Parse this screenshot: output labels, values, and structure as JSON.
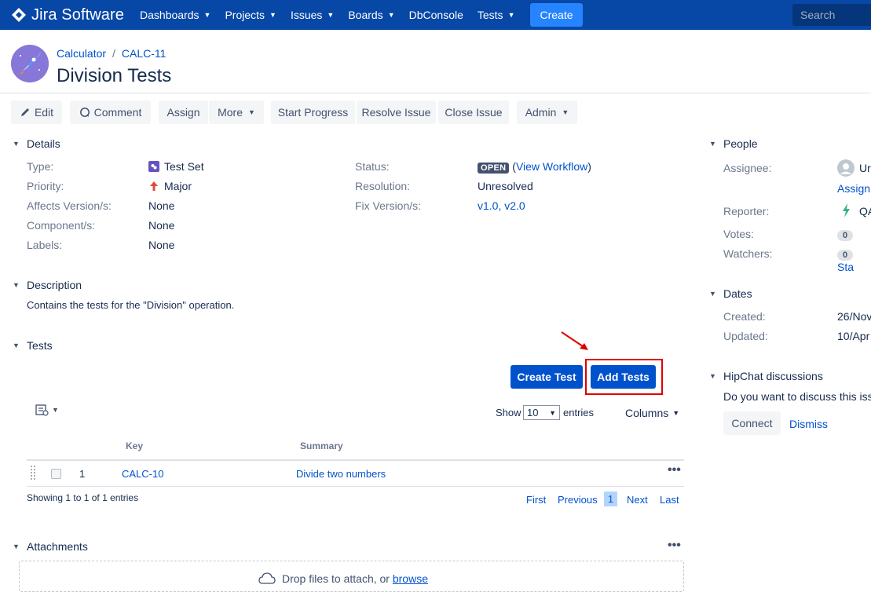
{
  "nav": {
    "logo_text": "Jira Software",
    "items": [
      {
        "label": "Dashboards",
        "dropdown": true
      },
      {
        "label": "Projects",
        "dropdown": true
      },
      {
        "label": "Issues",
        "dropdown": true
      },
      {
        "label": "Boards",
        "dropdown": true
      },
      {
        "label": "DbConsole",
        "dropdown": false
      },
      {
        "label": "Tests",
        "dropdown": true
      }
    ],
    "create_label": "Create",
    "search_placeholder": "Search"
  },
  "header": {
    "project_name": "Calculator",
    "separator": "/",
    "issue_key": "CALC-11",
    "title": "Division Tests"
  },
  "toolbar": {
    "edit": "Edit",
    "comment": "Comment",
    "assign": "Assign",
    "more": "More",
    "start_progress": "Start Progress",
    "resolve_issue": "Resolve Issue",
    "close_issue": "Close Issue",
    "admin": "Admin"
  },
  "details": {
    "heading": "Details",
    "left": [
      {
        "label": "Type:",
        "value": "Test Set"
      },
      {
        "label": "Priority:",
        "value": "Major"
      },
      {
        "label": "Affects Version/s:",
        "value": "None"
      },
      {
        "label": "Component/s:",
        "value": "None"
      },
      {
        "label": "Labels:",
        "value": "None"
      }
    ],
    "status_label": "Status:",
    "status_value": "OPEN",
    "view_workflow": "View Workflow",
    "resolution_label": "Resolution:",
    "resolution_value": "Unresolved",
    "fix_label": "Fix Version/s:",
    "fix_value": "v1.0, v2.0"
  },
  "description": {
    "heading": "Description",
    "text": "Contains the tests for the \"Division\" operation."
  },
  "tests": {
    "heading": "Tests",
    "create_test": "Create Test",
    "add_tests": "Add Tests",
    "show_label": "Show",
    "page_size": "10",
    "entries_label": "entries",
    "columns_label": "Columns",
    "col_key": "Key",
    "col_summary": "Summary",
    "rows": [
      {
        "index": "1",
        "key": "CALC-10",
        "summary": "Divide two numbers"
      }
    ],
    "showing": "Showing 1 to 1 of 1 entries",
    "pager": {
      "first": "First",
      "previous": "Previous",
      "current": "1",
      "next": "Next",
      "last": "Last"
    }
  },
  "attachments": {
    "heading": "Attachments",
    "drop_text": "Drop files to attach, or",
    "browse": "browse"
  },
  "people": {
    "heading": "People",
    "assignee_label": "Assignee:",
    "assignee_value": "Ur",
    "assign_link": "Assign",
    "reporter_label": "Reporter:",
    "reporter_value": "QA",
    "votes_label": "Votes:",
    "votes_count": "0",
    "watchers_label": "Watchers:",
    "watchers_count": "0",
    "watch_link": "Sta"
  },
  "dates": {
    "heading": "Dates",
    "created_label": "Created:",
    "created_value": "26/Nov",
    "updated_label": "Updated:",
    "updated_value": "10/Apr"
  },
  "hipchat": {
    "heading": "HipChat discussions",
    "prompt": "Do you want to discuss this iss",
    "connect": "Connect",
    "dismiss": "Dismiss"
  },
  "colors": {
    "nav_bg": "#0747a6",
    "primary": "#0052cc",
    "annotation_red": "#e00000"
  }
}
